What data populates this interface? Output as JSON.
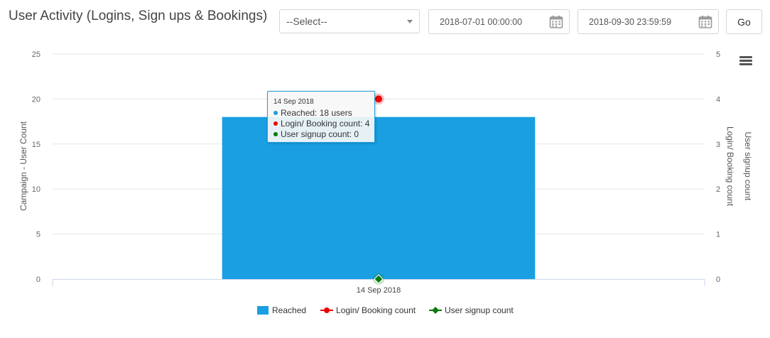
{
  "header": {
    "title": "User Activity (Logins, Sign ups & Bookings)",
    "select_value": "--Select--",
    "start_date": "2018-07-01 00:00:00",
    "end_date": "2018-09-30 23:59:59",
    "go_label": "Go"
  },
  "colors": {
    "bar": "#1a9fe2",
    "login": "#ee0000",
    "signup": "#0a7a0a",
    "grid": "#e6e6e6",
    "axis_text": "#666666"
  },
  "tooltip": {
    "date": "14 Sep 2018",
    "rows": [
      {
        "text": "Reached: 18 users",
        "color": "#1a9fe2"
      },
      {
        "text": "Login/ Booking count: 4",
        "color": "#ee0000"
      },
      {
        "text": "User signup count: 0",
        "color": "#0a7a0a"
      }
    ]
  },
  "chart_data": {
    "type": "bar",
    "categories": [
      "14 Sep 2018"
    ],
    "ylabel": "Campaign - User Count",
    "y2label": "Login/ Booking count",
    "y3label": "User signup count",
    "ylim": [
      0,
      25
    ],
    "y2lim": [
      0,
      5
    ],
    "yticks": [
      0,
      5,
      10,
      15,
      20,
      25
    ],
    "y2ticks": [
      0,
      1,
      2,
      3,
      4,
      5
    ],
    "grid": true,
    "legend_position": "bottom-center",
    "series": [
      {
        "name": "Reached",
        "type": "bar",
        "axis": "left",
        "values": [
          18
        ]
      },
      {
        "name": "Login/ Booking count",
        "type": "line",
        "axis": "right",
        "values": [
          4
        ]
      },
      {
        "name": "User signup count",
        "type": "line",
        "axis": "right",
        "values": [
          0
        ]
      }
    ]
  }
}
